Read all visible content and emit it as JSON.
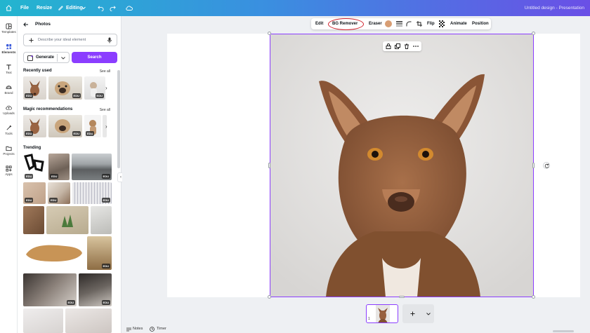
{
  "topbar": {
    "file_label": "File",
    "resize_label": "Resize",
    "editing_label": "Editing",
    "title": "Untitled design - Presentation"
  },
  "rail": {
    "items": [
      {
        "label": "Templates",
        "icon": "templates-icon"
      },
      {
        "label": "Elements",
        "icon": "elements-icon"
      },
      {
        "label": "Text",
        "icon": "text-icon"
      },
      {
        "label": "Brand",
        "icon": "brand-icon"
      },
      {
        "label": "Uploads",
        "icon": "uploads-icon"
      },
      {
        "label": "Tools",
        "icon": "tools-icon"
      },
      {
        "label": "Projects",
        "icon": "projects-icon"
      },
      {
        "label": "Apps",
        "icon": "apps-icon"
      }
    ]
  },
  "panel": {
    "title": "Photos",
    "search_placeholder": "Describe your ideal element",
    "generate_label": "Generate",
    "search_label": "Search",
    "recently_used": "Recently used",
    "magic": "Magic recommendations",
    "see_all": "See all",
    "trending": "Trending",
    "edu_badge": "EDU"
  },
  "toolbar": {
    "edit": "Edit",
    "bg_remover": "BG Remover",
    "eraser": "Eraser",
    "flip": "Flip",
    "animate": "Animate",
    "position": "Position"
  },
  "page_indicator": "1",
  "footer": {
    "notes": "Notes",
    "timer": "Timer"
  },
  "colors": {
    "accent": "#8b3dff",
    "highlight_ring": "#d1242f",
    "swatch": "#d89e74"
  }
}
